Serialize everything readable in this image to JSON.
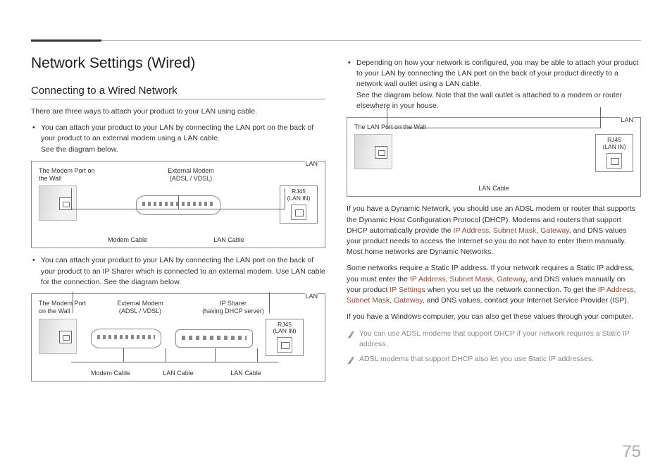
{
  "page_number": "75",
  "left": {
    "h1": "Network Settings (Wired)",
    "h2": "Connecting to a Wired Network",
    "intro": "There are three ways to attach your product to your LAN using cable.",
    "b1": "You can attach your product to your LAN by connecting the LAN port on the back of your product to an external modem using a LAN cable.\nSee the diagram below.",
    "b2": "You can attach your product to your LAN by connecting the LAN port on the back of your product to an IP Sharer which is connected to an external modem. Use LAN cable for the connection. See the diagram below.",
    "diagram1": {
      "wall_label": "The Modem Port on the Wall",
      "modem_label": "External Modem",
      "modem_sub": "(ADSL / VDSL)",
      "lan_header": "LAN",
      "lan_label1": "RJ45",
      "lan_label2": "(LAN IN)",
      "cable1": "Modem Cable",
      "cable2": "LAN Cable"
    },
    "diagram2": {
      "wall_label": "The Modem Port on the Wall",
      "modem_label": "External Modem",
      "modem_sub": "(ADSL / VDSL)",
      "sharer_label": "IP Sharer",
      "sharer_sub": "(having DHCP server)",
      "lan_header": "LAN",
      "lan_label1": "RJ45",
      "lan_label2": "(LAN IN)",
      "cable1": "Modem Cable",
      "cable2": "LAN Cable",
      "cable3": "LAN Cable"
    }
  },
  "right": {
    "b1a": "Depending on how your network is configured, you may be able to attach your product to your LAN by connecting the LAN port on the back of your product directly to a network wall outlet using a LAN cable.",
    "b1b": "See the diagram below. Note that the wall outlet is attached to a modem or router elsewhere in your house.",
    "diagram3": {
      "wall_label": "The LAN Port on the Wall",
      "lan_header": "LAN",
      "lan_label1": "RJ45",
      "lan_label2": "(LAN IN)",
      "cable1": "LAN Cable"
    },
    "p1a": "If you have a Dynamic Network, you should use an ADSL modem or router that supports the Dynamic Host Configuration Protocol (DHCP). Modems and routers that support DHCP automatically provide the ",
    "p1b": ", and DNS values your product needs to access the Internet so you do not have to enter them manually. Most home networks are Dynamic Networks.",
    "p2a": "Some networks require a Static IP address. If your network requires a Static IP address, you must enter the ",
    "p2b": ", and DNS values manually on your product ",
    "p2c": " when you set up the network connection. To get the ",
    "p2d": ", and DNS values, contact your Internet Service Provider (ISP).",
    "p3": "If you have a Windows computer, you can also get these values through your computer.",
    "note1": "You can use ADSL modems that support DHCP if your network requires a Static IP address.",
    "note2": "ADSL modems that support DHCP also let you use Static IP addresses.",
    "links": {
      "ip": "IP Address",
      "subnet": "Subnet Mask",
      "gateway": "Gateway",
      "settings": "IP Settings"
    }
  }
}
